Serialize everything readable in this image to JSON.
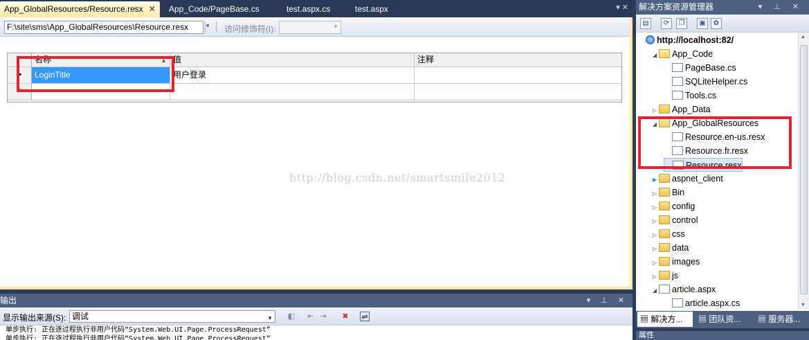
{
  "editor": {
    "tabs": [
      {
        "label": "App_GlobalResources/Resource.resx",
        "active": true
      },
      {
        "label": "App_Code/PageBase.cs",
        "active": false
      },
      {
        "label": "test.aspx.cs",
        "active": false
      },
      {
        "label": "test.aspx",
        "active": false
      }
    ],
    "tab_close_glyph": "✕",
    "tab_dropdown_glyph": "▾ ✕"
  },
  "resource_toolbar": {
    "path_value": "F:\\site\\sms\\App_GlobalResources\\Resource.resx",
    "access_modifier_label": "访问修饰符(I):",
    "access_modifier_value": ""
  },
  "grid": {
    "columns": [
      "名称",
      "值",
      "注释"
    ],
    "rows": [
      {
        "indicator": "▶",
        "name": "LoginTitle",
        "value": "用户登录",
        "comment": ""
      },
      {
        "indicator": "*",
        "name": "",
        "value": "",
        "comment": ""
      }
    ]
  },
  "watermark": "http://blog.csdn.net/smartsmile2012",
  "output": {
    "title": "输出",
    "source_label": "显示输出来源(S):",
    "source_value": "调试",
    "lines": [
      "单步执行: 正在逐过程执行非用户代码“System.Web.UI.Page.ProcessRequest”",
      "单步执行: 正在逐过程执行非用户代码“System.Web.UI.Page.ProcessRequest”"
    ],
    "pane_buttons": "▾ ⊥ ✕"
  },
  "solution_explorer": {
    "title": "解决方案资源管理器",
    "pane_buttons": "▾ ⊥ ✕",
    "tree": [
      {
        "label": "http://localhost:82/",
        "icon": "web-icon",
        "depth": 0,
        "expander": "",
        "bold": true
      },
      {
        "label": "App_Code",
        "icon": "folder-open-icon",
        "depth": 1,
        "expander": "◢"
      },
      {
        "label": "PageBase.cs",
        "icon": "cs-file-icon",
        "depth": 2,
        "expander": ""
      },
      {
        "label": "SQLiteHelper.cs",
        "icon": "cs-file-icon",
        "depth": 2,
        "expander": ""
      },
      {
        "label": "Tools.cs",
        "icon": "cs-file-icon",
        "depth": 2,
        "expander": ""
      },
      {
        "label": "App_Data",
        "icon": "folder-icon",
        "depth": 1,
        "expander": "▷"
      },
      {
        "label": "App_GlobalResources",
        "icon": "folder-open-icon",
        "depth": 1,
        "expander": "◢"
      },
      {
        "label": "Resource.en-us.resx",
        "icon": "resx-file-icon",
        "depth": 2,
        "expander": ""
      },
      {
        "label": "Resource.fr.resx",
        "icon": "resx-file-icon",
        "depth": 2,
        "expander": ""
      },
      {
        "label": "Resource.resx",
        "icon": "resx-file-icon",
        "depth": 2,
        "expander": "",
        "selected": true
      },
      {
        "label": "aspnet_client",
        "icon": "folder-icon",
        "depth": 1,
        "expander": "▶"
      },
      {
        "label": "Bin",
        "icon": "folder-icon",
        "depth": 1,
        "expander": "▷"
      },
      {
        "label": "config",
        "icon": "folder-icon",
        "depth": 1,
        "expander": "▷"
      },
      {
        "label": "control",
        "icon": "folder-icon",
        "depth": 1,
        "expander": "▷"
      },
      {
        "label": "css",
        "icon": "folder-icon",
        "depth": 1,
        "expander": "▷"
      },
      {
        "label": "data",
        "icon": "folder-icon",
        "depth": 1,
        "expander": "▷"
      },
      {
        "label": "images",
        "icon": "folder-icon",
        "depth": 1,
        "expander": "▷"
      },
      {
        "label": "js",
        "icon": "folder-icon",
        "depth": 1,
        "expander": "▷"
      },
      {
        "label": "article.aspx",
        "icon": "aspx-file-icon",
        "depth": 1,
        "expander": "◢"
      },
      {
        "label": "article.aspx.cs",
        "icon": "cs-file-icon",
        "depth": 2,
        "expander": ""
      }
    ],
    "bottom_tabs": [
      {
        "label": "解决方...",
        "active": true
      },
      {
        "label": "团队资...",
        "active": false
      },
      {
        "label": "服务器...",
        "active": false
      }
    ]
  },
  "properties": {
    "title": "属性"
  },
  "colors": {
    "annotation_red": "#e5232e",
    "selection_blue": "#3399ff",
    "title_bar": "#4d6082",
    "active_tab": "#ffe8a6"
  }
}
